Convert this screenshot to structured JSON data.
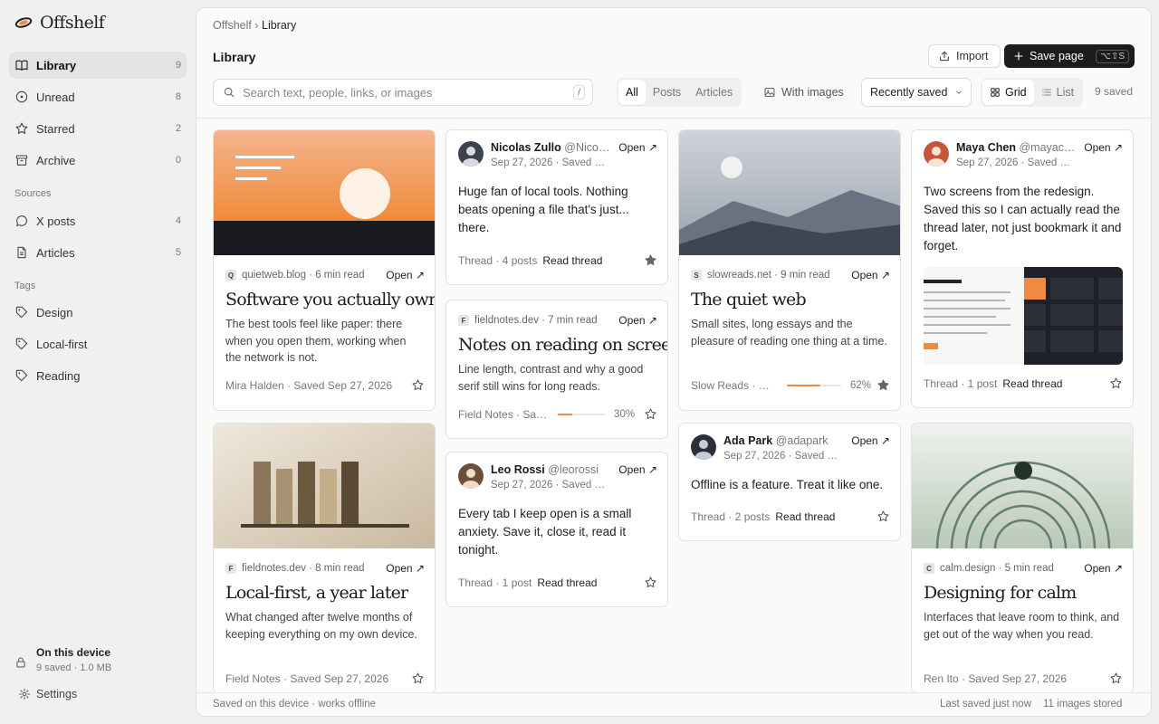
{
  "app": {
    "name": "Offshelf"
  },
  "sidebar": {
    "items": [
      {
        "label": "Library",
        "count": "9",
        "icon": "book-icon"
      },
      {
        "label": "Unread",
        "count": "8",
        "icon": "circle-dot-icon"
      },
      {
        "label": "Starred",
        "count": "2",
        "icon": "star-icon"
      },
      {
        "label": "Archive",
        "count": "0",
        "icon": "archive-icon"
      }
    ],
    "sources_title": "Sources",
    "sources": [
      {
        "label": "X posts",
        "count": "4",
        "icon": "chat-bubble-icon"
      },
      {
        "label": "Articles",
        "count": "5",
        "icon": "document-icon"
      }
    ],
    "tags_title": "Tags",
    "tags": [
      {
        "label": "Design",
        "icon": "tag-icon"
      },
      {
        "label": "Local-first",
        "icon": "tag-icon"
      },
      {
        "label": "Reading",
        "icon": "tag-icon"
      }
    ],
    "device": {
      "title": "On this device",
      "info": "9 saved · 1.0 MB"
    },
    "settings_label": "Settings"
  },
  "header": {
    "breadcrumb": {
      "root": "Offshelf",
      "sep": "›",
      "current": "Library"
    },
    "title": "Library",
    "import_label": "Import",
    "save_label": "Save page",
    "save_shortcut": "⌥⇧S"
  },
  "toolbar": {
    "search_placeholder": "Search text, people, links, or images",
    "search_shortcut": "/",
    "filters": [
      "All",
      "Posts",
      "Articles"
    ],
    "with_images": "With images",
    "sort": "Recently saved",
    "views": [
      "Grid",
      "List"
    ],
    "count": "9 saved"
  },
  "cards": {
    "c1": {
      "favicon": "Q",
      "meta": "quietweb.blog · 6 min read",
      "open": "Open ↗",
      "title": "Software you actually own",
      "desc": "The best tools feel like paper: there when you open them, working when the network is not.",
      "footer": "Mira Halden · Saved Sep 27, 2026"
    },
    "c2": {
      "favicon": "F",
      "meta": "fieldnotes.dev · 8 min read",
      "open": "Open ↗",
      "title": "Local-first, a year later",
      "desc": "What changed after twelve months of keeping everything on my own device.",
      "footer": "Field Notes · Saved Sep 27, 2026"
    },
    "c3": {
      "name": "Nicolas Zullo",
      "handle": "@Nico…",
      "date": "Sep 27, 2026 · Saved …",
      "open": "Open ↗",
      "body": "Huge fan of local tools. Nothing beats opening a file that's just... there.",
      "footer": "Thread · 4 posts",
      "read": "Read thread"
    },
    "c4": {
      "favicon": "F",
      "meta": "fieldnotes.dev · 7 min read",
      "open": "Open ↗",
      "title": "Notes on reading on screens",
      "desc": "Line length, contrast and why a good serif still wins for long reads.",
      "footer": "Field Notes · Sa…",
      "progress": 0.3,
      "progress_label": "30%"
    },
    "c5": {
      "name": "Leo Rossi",
      "handle": "@leorossi",
      "date": "Sep 27, 2026 · Saved …",
      "open": "Open ↗",
      "body": "Every tab I keep open is a small anxiety. Save it, close it, read it tonight.",
      "footer": "Thread · 1 post",
      "read": "Read thread"
    },
    "c6": {
      "favicon": "S",
      "meta": "slowreads.net · 9 min read",
      "open": "Open ↗",
      "title": "The quiet web",
      "desc": "Small sites, long essays and the pleasure of reading one thing at a time.",
      "footer": "Slow Reads · Sa…",
      "progress": 0.62,
      "progress_label": "62%"
    },
    "c7": {
      "name": "Ada Park",
      "handle": "@adapark",
      "date": "Sep 27, 2026 · Saved …",
      "open": "Open ↗",
      "body": "Offline is a feature. Treat it like one.",
      "footer": "Thread · 2 posts",
      "read": "Read thread"
    },
    "c8": {
      "name": "Maya Chen",
      "handle": "@mayac…",
      "date": "Sep 27, 2026 · Saved …",
      "open": "Open ↗",
      "body": "Two screens from the redesign. Saved this so I can actually read the thread later, not just bookmark it and forget.",
      "footer": "Thread · 1 post",
      "read": "Read thread"
    },
    "c9": {
      "favicon": "C",
      "meta": "calm.design · 5 min read",
      "open": "Open ↗",
      "title": "Designing for calm",
      "desc": "Interfaces that leave room to think, and get out of the way when you read.",
      "footer": "Ren Ito · Saved Sep 27, 2026"
    }
  },
  "status": {
    "left": "Saved on this device · works offline",
    "last_saved": "Last saved just now",
    "images": "11 images stored"
  },
  "colors": {
    "accent": "#ef8a43",
    "dark": "#1c1c1c",
    "star_filled": "#666666"
  }
}
